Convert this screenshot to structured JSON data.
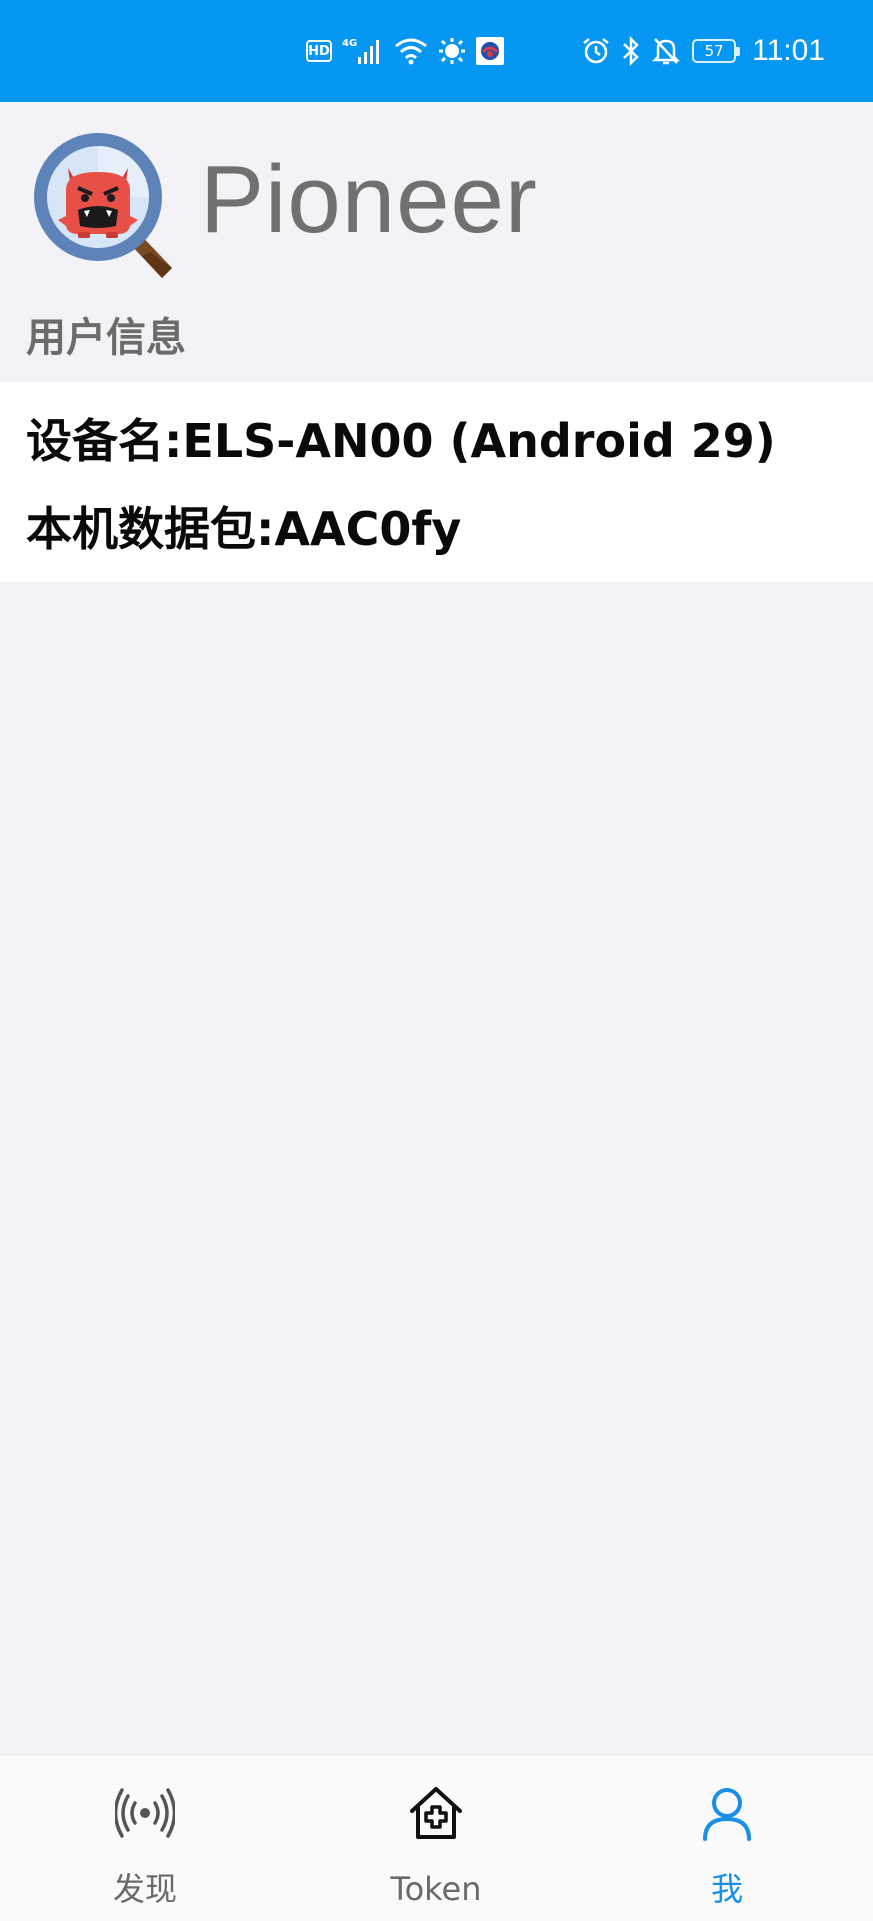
{
  "status_bar": {
    "hd_label": "HD",
    "network": "4G",
    "battery_level": "57",
    "time": "11:01",
    "background_color": "#0597f2",
    "icons": [
      "hd-icon",
      "signal-icon",
      "wifi-icon",
      "brightness-icon",
      "app-notification-icon",
      "alarm-icon",
      "bluetooth-icon",
      "mute-icon",
      "battery-icon"
    ]
  },
  "header": {
    "app_name": "Pioneer",
    "logo_icon": "magnifier-monster-logo"
  },
  "user_info": {
    "section_title": "用户信息",
    "device_name": "设备名:ELS-AN00 (Android 29)",
    "local_packet": "本机数据包:AAC0fy"
  },
  "bottom_nav": {
    "active_color": "#1a8fe6",
    "items": [
      {
        "label": "发现",
        "icon": "broadcast-icon",
        "active": false
      },
      {
        "label": "Token",
        "icon": "medical-house-icon",
        "active": false
      },
      {
        "label": "我",
        "icon": "user-icon",
        "active": true
      }
    ]
  }
}
